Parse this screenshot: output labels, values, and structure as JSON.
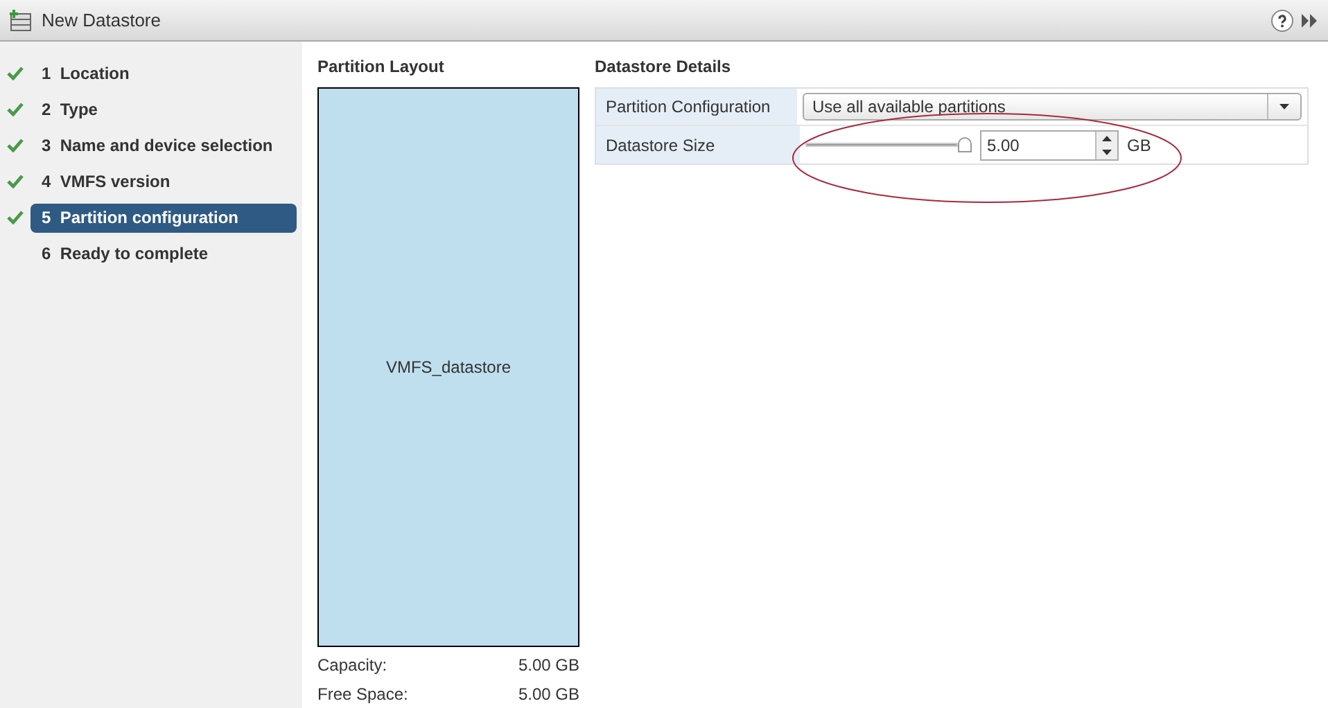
{
  "window": {
    "title": "New Datastore"
  },
  "steps": [
    {
      "number": "1",
      "label": "Location",
      "checked": true,
      "selected": false
    },
    {
      "number": "2",
      "label": "Type",
      "checked": true,
      "selected": false
    },
    {
      "number": "3",
      "label": "Name and device selection",
      "checked": true,
      "selected": false
    },
    {
      "number": "4",
      "label": "VMFS version",
      "checked": true,
      "selected": false
    },
    {
      "number": "5",
      "label": "Partition configuration",
      "checked": true,
      "selected": true
    },
    {
      "number": "6",
      "label": "Ready to complete",
      "checked": false,
      "selected": false
    }
  ],
  "partition_layout": {
    "title": "Partition Layout",
    "partition": "VMFS_datastore",
    "capacity_label": "Capacity:",
    "capacity": "5.00 GB",
    "free_label": "Free Space:",
    "free": "5.00 GB"
  },
  "details": {
    "title": "Datastore Details",
    "partition_configuration": {
      "label": "Partition Configuration",
      "value": "Use all available partitions"
    },
    "datastore_size": {
      "label": "Datastore Size",
      "level": 1,
      "value": "5.00",
      "unit": "GB"
    }
  },
  "annotation": {
    "kind": "ellipse",
    "color": "#a8283a"
  }
}
